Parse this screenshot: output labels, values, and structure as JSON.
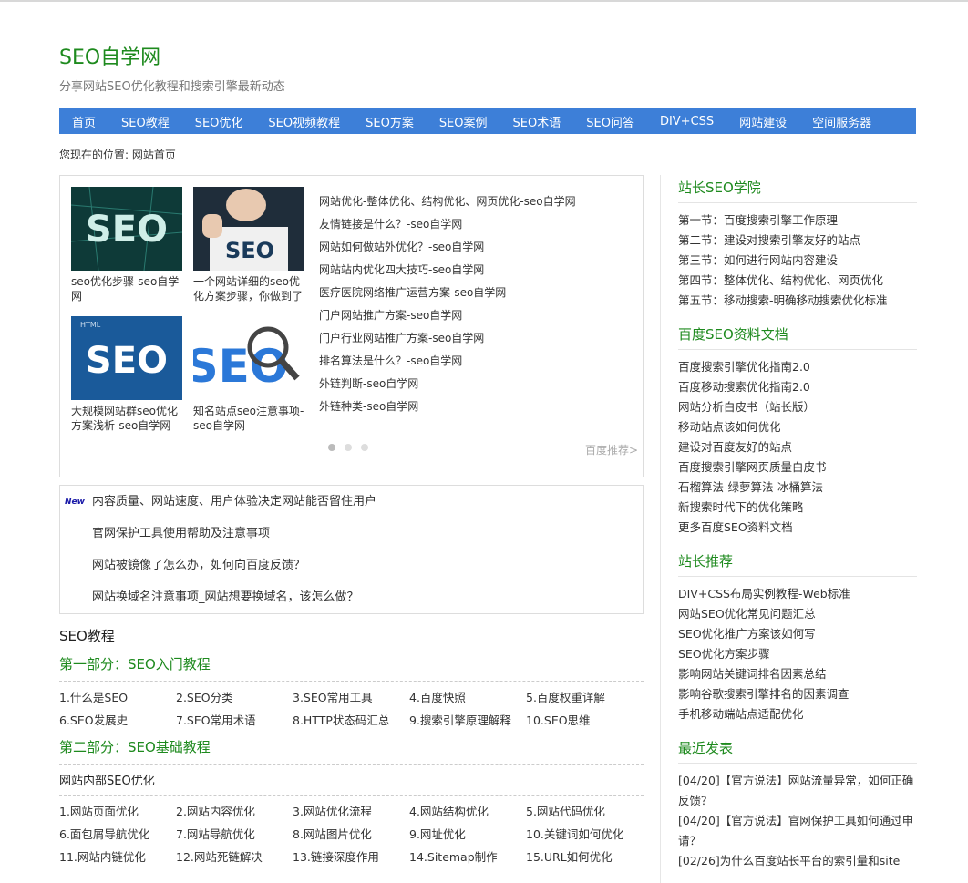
{
  "header": {
    "site_title": "SEO自学网",
    "site_desc": "分享网站SEO优化教程和搜索引擎最新动态"
  },
  "nav": [
    "首页",
    "SEO教程",
    "SEO优化",
    "SEO视频教程",
    "SEO方案",
    "SEO案例",
    "SEO术语",
    "SEO问答",
    "DIV+CSS",
    "网站建设",
    "空间服务器"
  ],
  "breadcrumb": "您现在的位置: 网站首页",
  "feature": {
    "thumbs": [
      {
        "caption": "seo优化步骤-seo自学网",
        "img_text": "SEO"
      },
      {
        "caption": "一个网站详细的seo优化方案步骤，你做到了",
        "img_text": "SEO"
      },
      {
        "caption": "大规模网站群seo优化方案浅析-seo自学网",
        "img_text": "SEO",
        "img_small": "HTML"
      },
      {
        "caption": "知名站点seo注意事项-seo自学网",
        "img_text": "SEO"
      }
    ],
    "list": [
      "网站优化-整体优化、结构优化、网页优化-seo自学网",
      "友情链接是什么？-seo自学网",
      "网站如何做站外优化？-seo自学网",
      "网站站内优化四大技巧-seo自学网",
      "医疗医院网络推广运营方案-seo自学网",
      "门户网站推广方案-seo自学网",
      "门户行业网站推广方案-seo自学网",
      "排名算法是什么？-seo自学网",
      "外链判断-seo自学网",
      "外链种类-seo自学网"
    ],
    "recommend": "百度推荐>"
  },
  "news": {
    "badge": "New",
    "items": [
      "内容质量、网站速度、用户体验决定网站能否留住用户",
      "官网保护工具使用帮助及注意事项",
      "网站被镜像了怎么办，如何向百度反馈？",
      "网站换域名注意事项_网站想要换域名，该怎么做？"
    ]
  },
  "tutorial": {
    "title": "SEO教程",
    "part1": {
      "title": "第一部分：SEO入门教程",
      "items": [
        "1.什么是SEO",
        "2.SEO分类",
        "3.SEO常用工具",
        "4.百度快照",
        "5.百度权重详解",
        "6.SEO发展史",
        "7.SEO常用术语",
        "8.HTTP状态码汇总",
        "9.搜索引擎原理解释",
        "10.SEO思维"
      ]
    },
    "part2": {
      "title": "第二部分：SEO基础教程",
      "subhead": "网站内部SEO优化",
      "items": [
        "1.网站页面优化",
        "2.网站内容优化",
        "3.网站优化流程",
        "4.网站结构优化",
        "5.网站代码优化",
        "6.面包屑导航优化",
        "7.网站导航优化",
        "8.网站图片优化",
        "9.网址优化",
        "10.关键词如何优化",
        "11.网站内链优化",
        "12.网站死链解决",
        "13.链接深度作用",
        "14.Sitemap制作",
        "15.URL如何优化"
      ]
    }
  },
  "sidebar": {
    "academy": {
      "title": "站长SEO学院",
      "items": [
        "第一节：百度搜索引擎工作原理",
        "第二节：建设对搜索引擎友好的站点",
        "第三节：如何进行网站内容建设",
        "第四节：整体优化、结构优化、网页优化",
        "第五节：移动搜索-明确移动搜索优化标准"
      ]
    },
    "docs": {
      "title": "百度SEO资料文档",
      "items": [
        "百度搜索引擎优化指南2.0",
        "百度移动搜索优化指南2.0",
        "网站分析白皮书（站长版）",
        "移动站点该如何优化",
        "建设对百度友好的站点",
        "百度搜索引擎网页质量白皮书",
        "石榴算法-绿萝算法-冰桶算法",
        "新搜索时代下的优化策略",
        "更多百度SEO资料文档"
      ]
    },
    "recommend": {
      "title": "站长推荐",
      "items": [
        "DIV+CSS布局实例教程-Web标准",
        "网站SEO优化常见问题汇总",
        "SEO优化推广方案该如何写",
        "SEO优化方案步骤",
        "影响网站关键词排名因素总结",
        "影响谷歌搜索引擎排名的因素调查",
        "手机移动端站点适配优化"
      ]
    },
    "recent": {
      "title": "最近发表",
      "items": [
        "[04/20]【官方说法】网站流量异常，如何正确反馈？",
        "[04/20]【官方说法】官网保护工具如何通过申请？",
        "[02/26]为什么百度站长平台的索引量和site"
      ]
    }
  },
  "colors": {
    "accent": "#3d7fd8",
    "brand": "#1e8a1e"
  }
}
